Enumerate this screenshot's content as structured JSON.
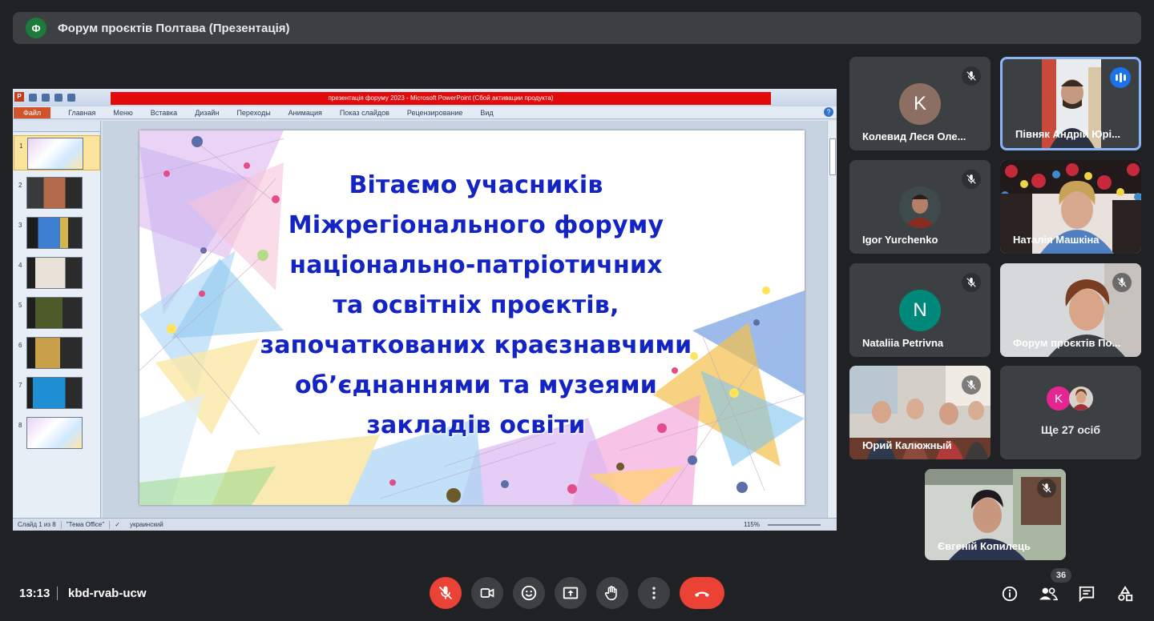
{
  "meeting": {
    "presenter_initial": "Ф",
    "title": "Форум проєктів Полтава (Презентація)",
    "time": "13:13",
    "code": "kbd-rvab-ucw",
    "participant_count": "36"
  },
  "ppt": {
    "window_title": "презентація форуму 2023  -  Microsoft PowerPoint (Сбой активации продукта)",
    "logo": "P",
    "file_tab": "Файл",
    "tabs": [
      "Главная",
      "Меню",
      "Вставка",
      "Дизайн",
      "Переходы",
      "Анимация",
      "Показ слайдов",
      "Рецензирование",
      "Вид"
    ],
    "help": "?",
    "thumb_numbers": [
      "1",
      "2",
      "3",
      "4",
      "5",
      "6",
      "7",
      "8"
    ],
    "status": {
      "slide_info": "Слайд 1 из 8",
      "theme": "\"Тема Office\"",
      "language": "украинский",
      "zoom": "115%"
    },
    "slide_lines": [
      "Вітаємо учасників",
      "Міжрегіонального форуму",
      "національно-патріотичних",
      "та освітніх проєктів,",
      "започаткованих краєзнавчими",
      "об’єднаннями та музеями",
      "закладів освіти"
    ]
  },
  "participants": [
    {
      "name": "Колевид Леся Оле...",
      "initial": "K",
      "avatar_color": "#8d6e63",
      "muted": true
    },
    {
      "name": "Півняк Андрій Юрі...",
      "speaking": true
    },
    {
      "name": "Igor Yurchenko",
      "muted": true
    },
    {
      "name": "Наталія Машкіна"
    },
    {
      "name": "Nataliia Petrivna",
      "initial": "N",
      "avatar_color": "#00897b",
      "muted": true
    },
    {
      "name": "Форум проєктів По...",
      "muted": true
    },
    {
      "name": "Юрий Калюжный",
      "muted": true
    },
    {
      "name": "Євгеній Копилець",
      "muted": true
    }
  ],
  "others": {
    "label": "Ще 27 осіб",
    "initial": "K"
  }
}
